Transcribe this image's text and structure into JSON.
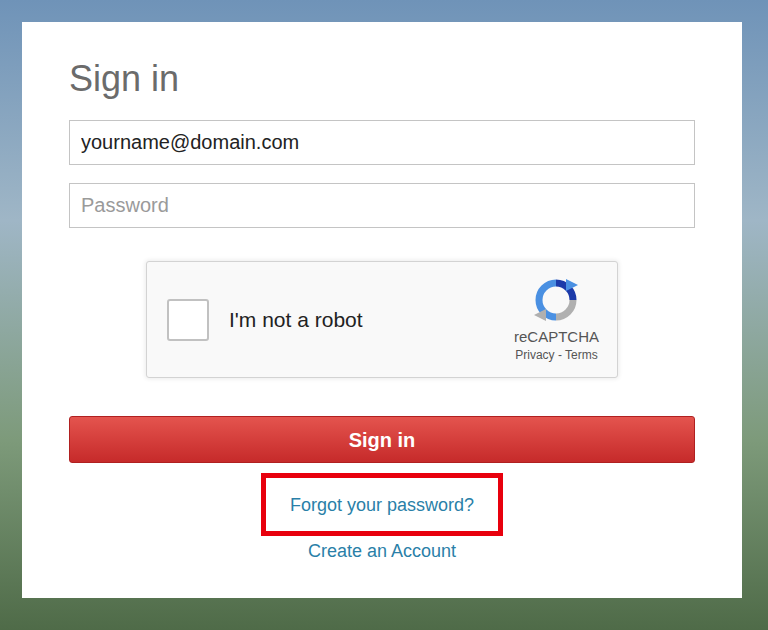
{
  "form": {
    "title": "Sign in",
    "fields": [
      {
        "name": "email",
        "value": "yourname@domain.com",
        "placeholder": ""
      },
      {
        "name": "password",
        "value": "",
        "placeholder": "Password"
      }
    ],
    "captcha": {
      "label": "I'm not a robot",
      "checked": false,
      "brand": "reCAPTCHA",
      "links": "Privacy - Terms"
    },
    "submit": "Sign in",
    "links": [
      {
        "label": "Forgot your password?",
        "highlighted": true
      },
      {
        "label": "Create an Account",
        "highlighted": false
      }
    ]
  }
}
